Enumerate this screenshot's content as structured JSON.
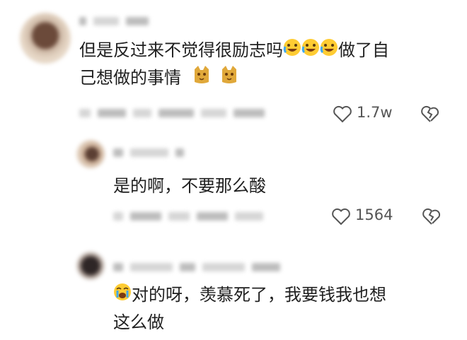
{
  "comments": [
    {
      "text_before_emoji": "但是反过来不觉得很励志吗",
      "text_after_emoji": "做了自",
      "text_line2": "己想做的事情",
      "like_count": "1.7w"
    },
    {
      "text": "是的啊，不要那么酸",
      "like_count": "1564"
    },
    {
      "text_line1": "对的呀，羡慕死了，我要钱我也想",
      "text_line2": "这么做"
    }
  ]
}
